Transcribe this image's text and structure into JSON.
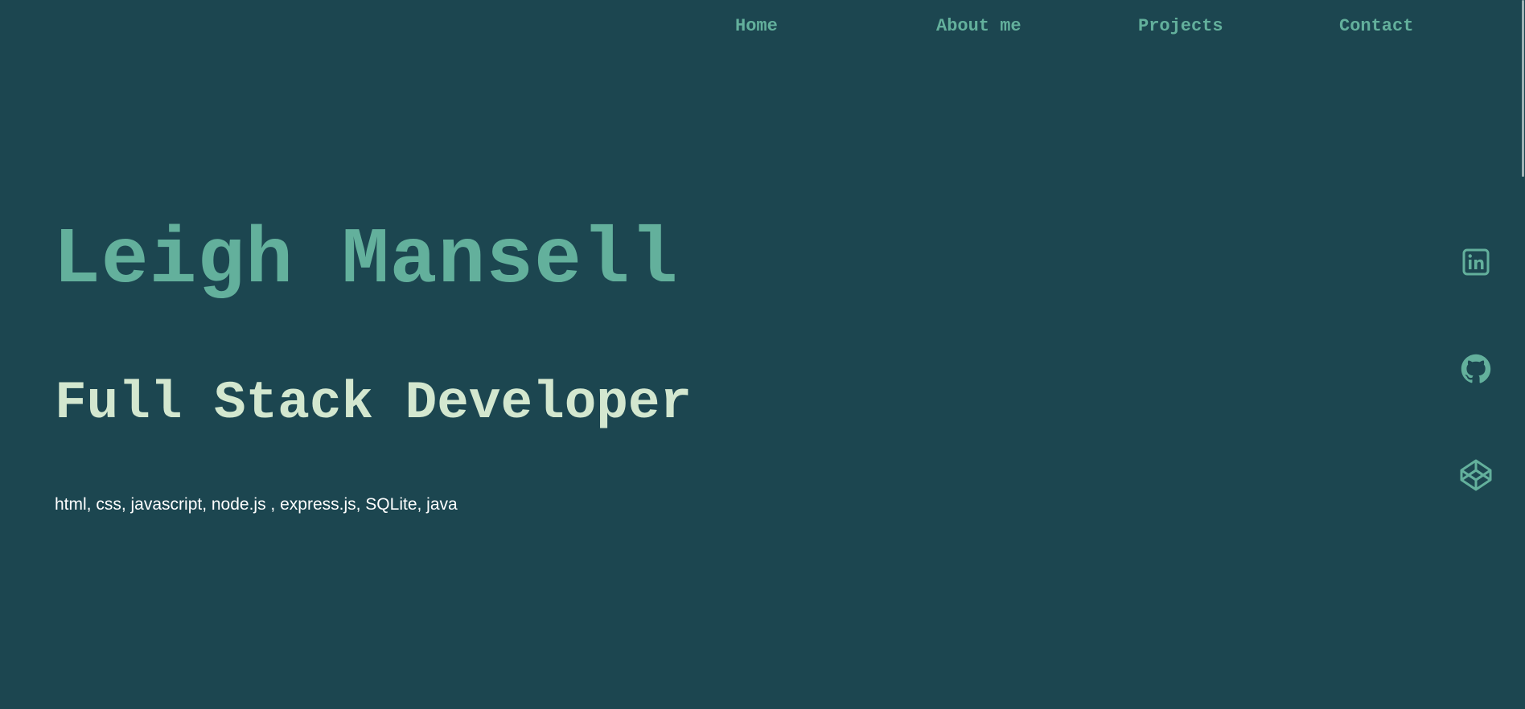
{
  "nav": {
    "items": [
      {
        "label": "Home"
      },
      {
        "label": "About me"
      },
      {
        "label": "Projects"
      },
      {
        "label": "Contact"
      }
    ]
  },
  "hero": {
    "name": "Leigh Mansell",
    "role": "Full Stack Developer",
    "skills": "html, css, javascript, node.js , express.js, SQLite, java"
  },
  "social": {
    "icons": [
      "linkedin-icon",
      "github-icon",
      "codepen-icon"
    ]
  },
  "colors": {
    "background": "#1c4650",
    "accent": "#63b09c",
    "role_text": "#d3e7cf",
    "body_text": "#ffffff"
  }
}
